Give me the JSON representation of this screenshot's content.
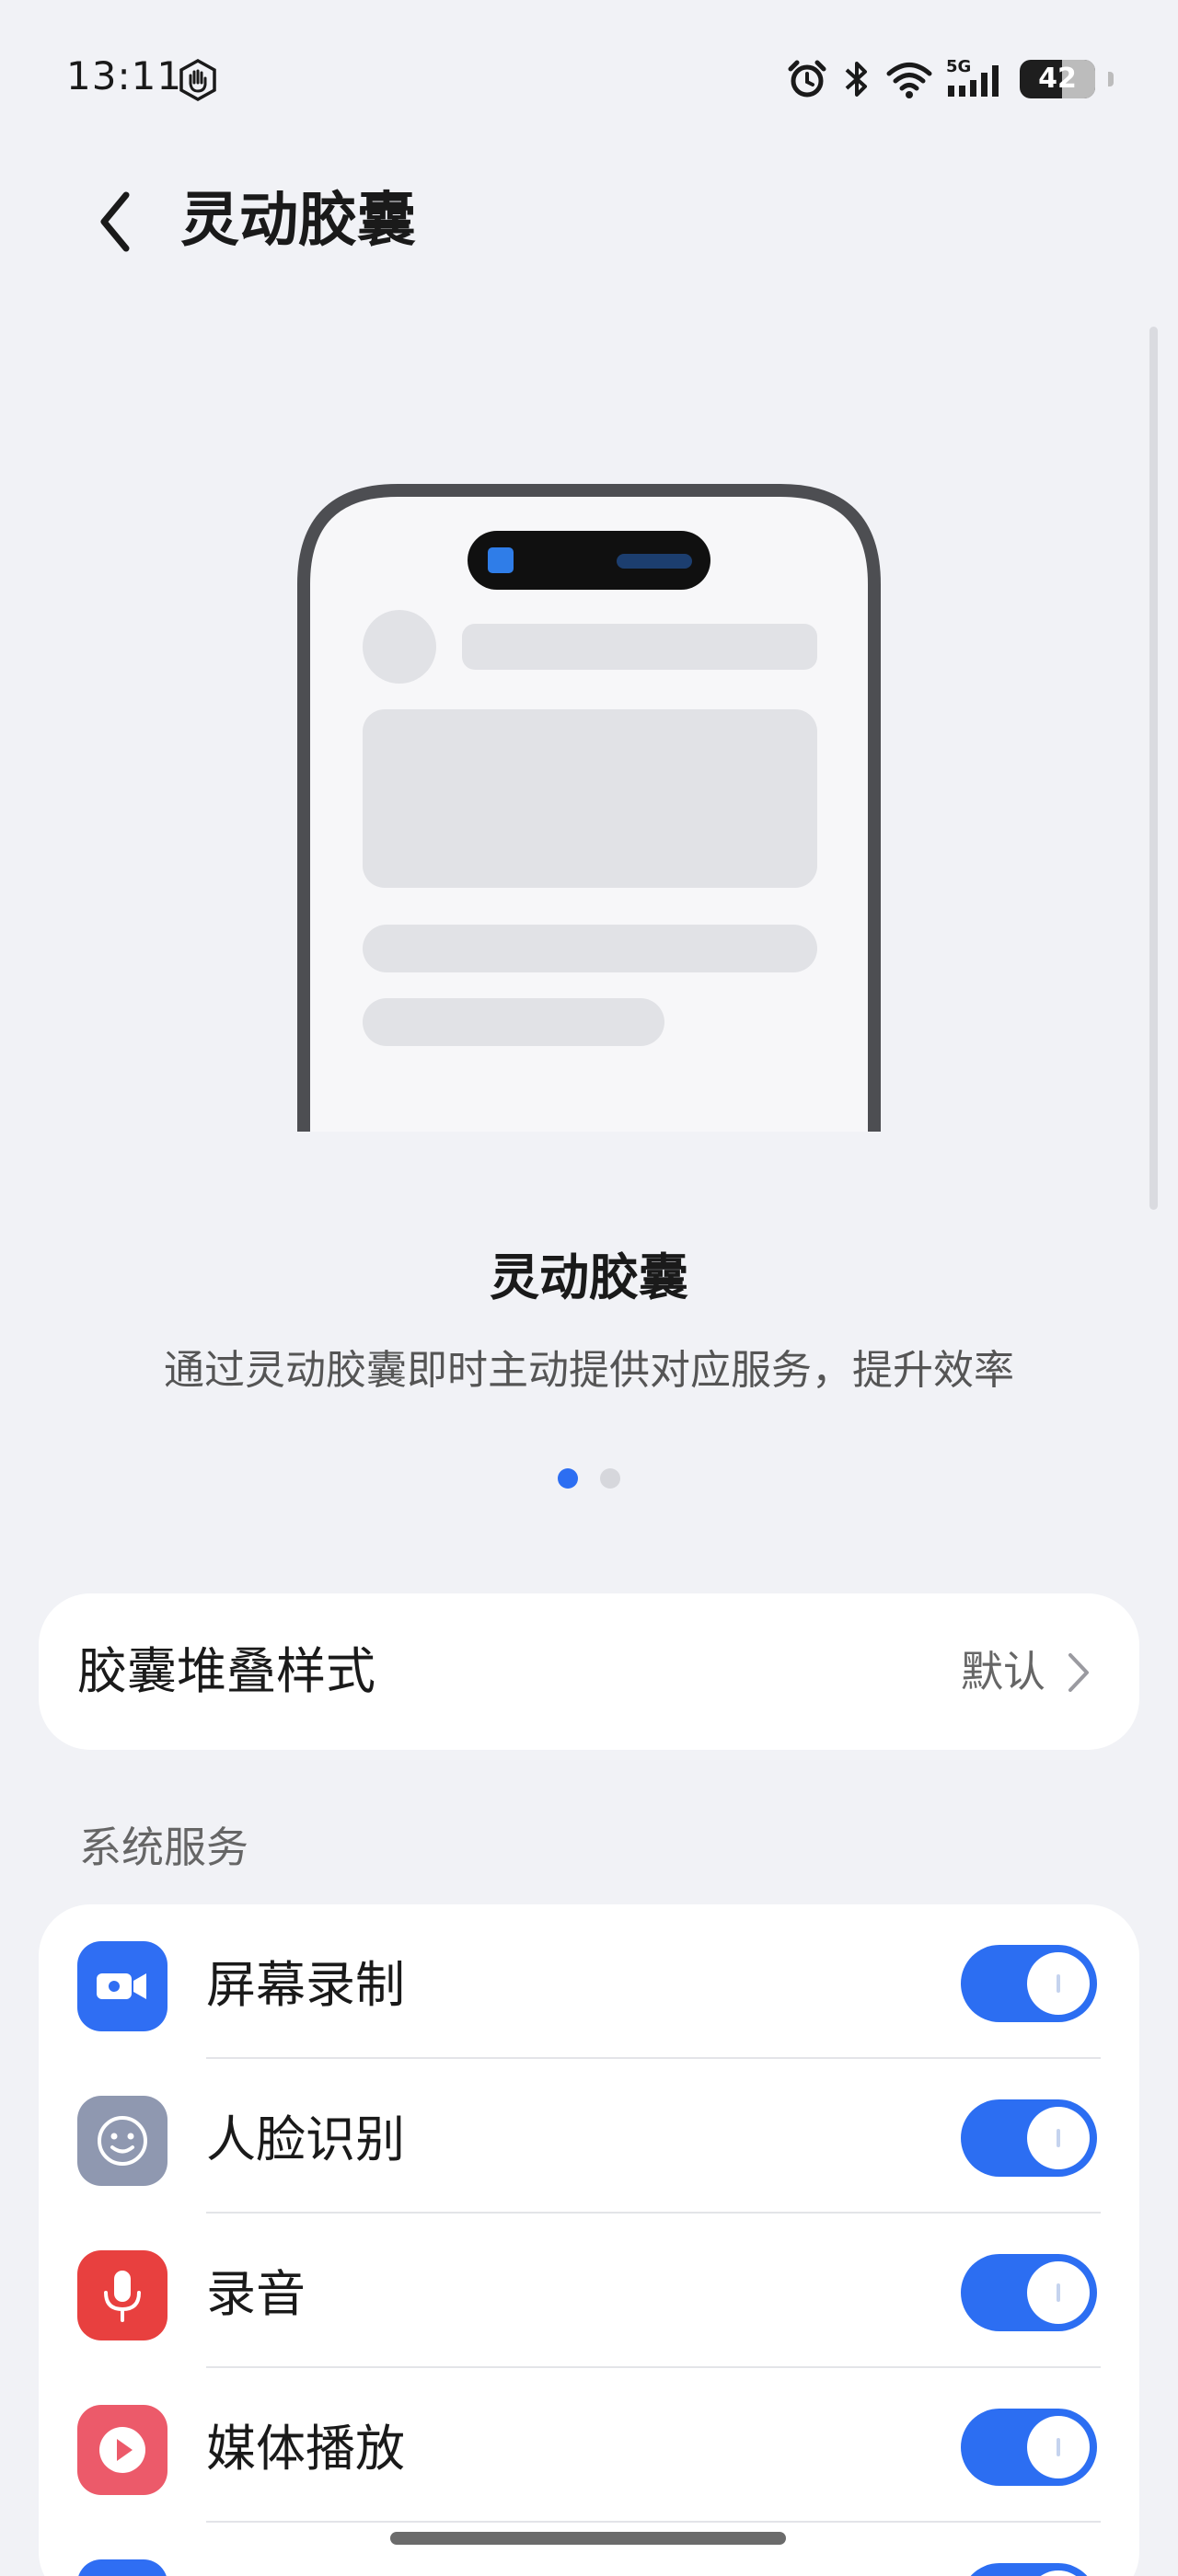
{
  "status_bar": {
    "time": "13:11",
    "network_label": "5G",
    "battery_level": "42"
  },
  "header": {
    "title": "灵动胶囊"
  },
  "intro": {
    "title": "灵动胶囊",
    "description": "通过灵动胶囊即时主动提供对应服务，提升效率",
    "page_count": 2,
    "active_page": 1
  },
  "stack_style": {
    "label": "胶囊堆叠样式",
    "value": "默认"
  },
  "system_services": {
    "section_label": "系统服务",
    "items": [
      {
        "label": "屏幕录制",
        "icon": "video-camera-icon",
        "icon_color": "#2f6ef3",
        "enabled": true
      },
      {
        "label": "人脸识别",
        "icon": "face-icon",
        "icon_color": "#8f98b0",
        "enabled": true
      },
      {
        "label": "录音",
        "icon": "microphone-icon",
        "icon_color": "#e8403f",
        "enabled": true
      },
      {
        "label": "媒体播放",
        "icon": "play-icon",
        "icon_color": "#ec5a6a",
        "enabled": true
      }
    ]
  },
  "colors": {
    "accent": "#2c6ef2",
    "background": "#f1f2f6",
    "card": "#ffffff"
  }
}
